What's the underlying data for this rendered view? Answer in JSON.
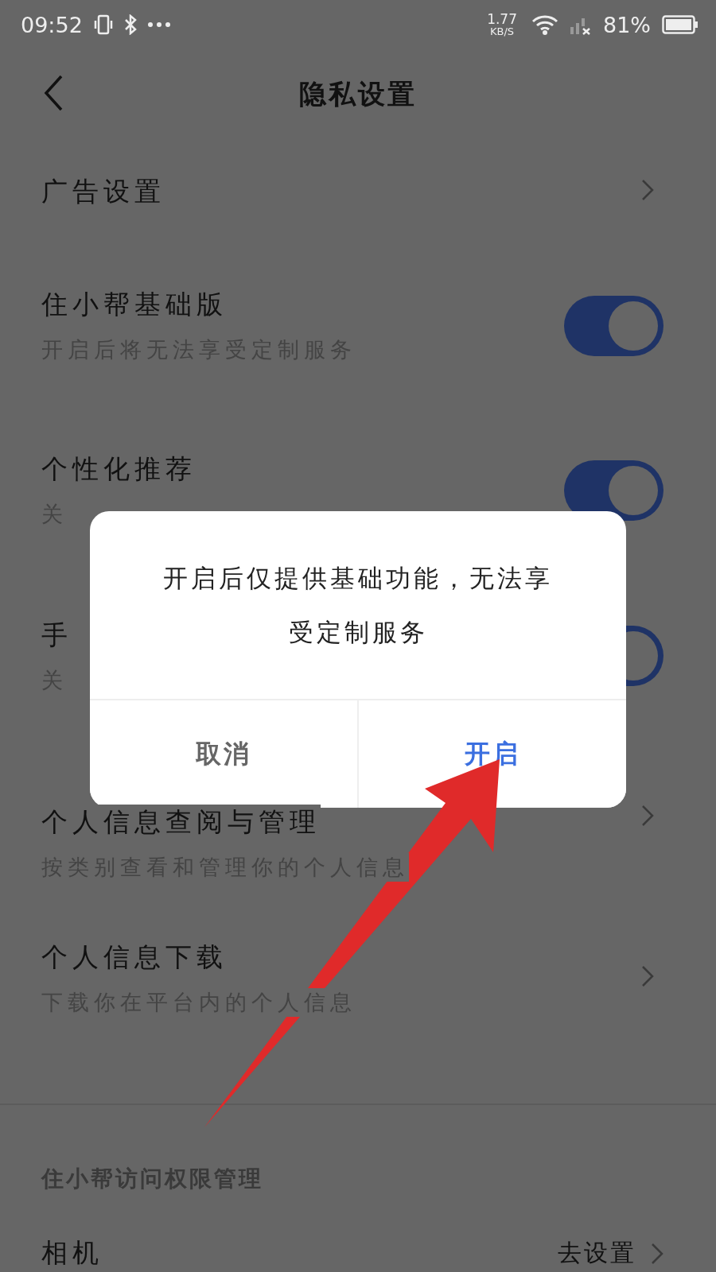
{
  "status_bar": {
    "time": "09:52",
    "speed": "1.77",
    "speed_unit": "KB/S",
    "battery": "81%"
  },
  "header": {
    "title": "隐私设置"
  },
  "rows": [
    {
      "kind": "link",
      "title": "广告设置"
    },
    {
      "kind": "toggle",
      "title": "住小帮基础版",
      "subtitle": "开启后将无法享受定制服务",
      "on": true
    },
    {
      "kind": "toggle",
      "title": "个性化推荐",
      "subtitle": "关",
      "on": true
    },
    {
      "kind": "toggle",
      "title": "手",
      "subtitle": "关",
      "on": true
    },
    {
      "kind": "link",
      "title": "个人信息查阅与管理",
      "subtitle": "按类别查看和管理你的个人信息"
    },
    {
      "kind": "link",
      "title": "个人信息下载",
      "subtitle": "下载你在平台内的个人信息"
    }
  ],
  "section": {
    "title": "住小帮访问权限管理",
    "rows": [
      {
        "title": "相机",
        "value": "去设置"
      }
    ]
  },
  "dialog": {
    "message": "开启后仅提供基础功能，无法享受定制服务",
    "buttons": [
      {
        "kind": "cancel",
        "label": "取消"
      },
      {
        "kind": "confirm",
        "label": "开启"
      }
    ]
  }
}
